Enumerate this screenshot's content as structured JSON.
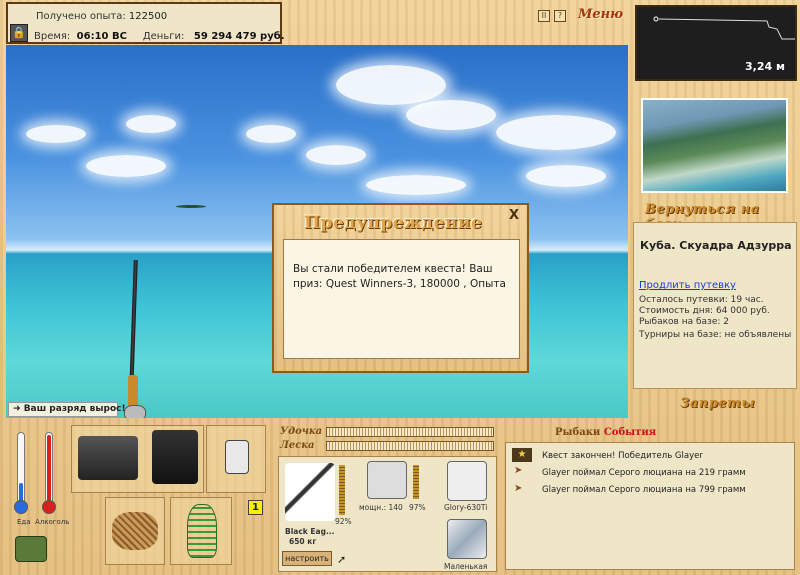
{
  "stats": {
    "exp_label": "Получено опыта:",
    "exp_value": "122500",
    "time_label": "Время:",
    "time_value": "06:10 ВС",
    "money_label": "Деньги:",
    "money_value": "59 294 479 руб."
  },
  "menu": {
    "label": "Меню",
    "pause": "II",
    "help": "?"
  },
  "depth": {
    "value": "3,24 м"
  },
  "base": {
    "return_label": "Вернуться на базу",
    "name": "Куба. Скуадра Адзурра",
    "extend_link": "Продлить путевку",
    "lines": [
      "Осталось путевки: 19 час.",
      "Стоимость дня: 64 000 руб.",
      "Рыбаков на базе: 2",
      "Турниры на базе: не объявлены"
    ],
    "bans_label": "Запреты"
  },
  "dialog": {
    "title": "Предупреждение",
    "close": "X",
    "message": "Вы стали победителем квеста! Ваш приз: Quest Winners-3, 180000 , Опыта"
  },
  "rank": {
    "text": "Ваш разряд вырос!"
  },
  "thermo": {
    "food_label": "Еда",
    "alcohol_label": "Алкоголь"
  },
  "inventory": {
    "count_badge": "1"
  },
  "rig": {
    "rod_label": "Удочка",
    "line_label": "Леска",
    "rod_name": "Black Eag...",
    "rod_weight": "650 кг",
    "rod_percent": "92%",
    "reel_power": "мощн.: 140",
    "reel_percent": "97%",
    "lure1": "Glory-630Ti",
    "lure2": "Маленькая",
    "tune_button": "настроить"
  },
  "events": {
    "title_part1": "Рыбаки",
    "title_part2": "События",
    "items": [
      "Квест закончен! Победитель Glayer",
      "Glayer поймал Серого люциана на 219 грамм",
      "Glayer поймал Серого люциана на 799 грамм"
    ]
  },
  "colors": {
    "accent": "#a33510",
    "link": "#1a3ad8",
    "wood": "#e8c98f"
  }
}
